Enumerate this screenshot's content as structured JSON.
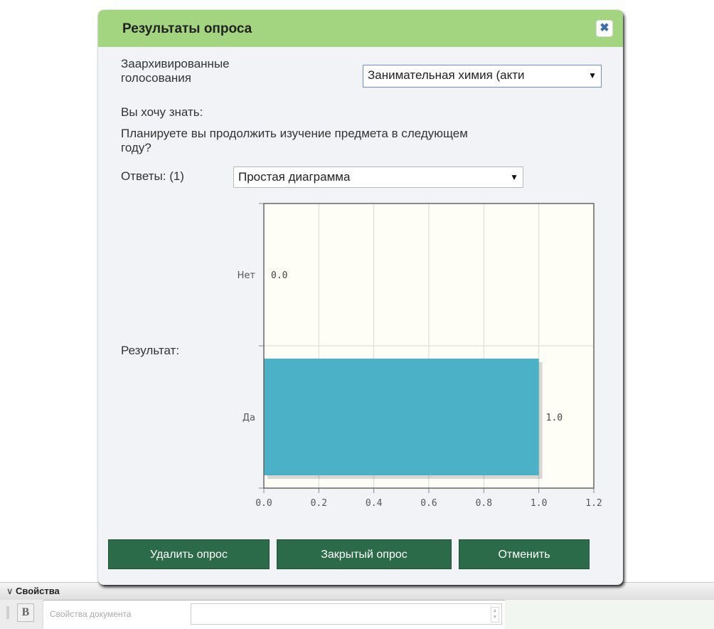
{
  "background": {
    "panel_title": "Свойства",
    "bold_button": "B",
    "property_label": "Свойства документа"
  },
  "dialog": {
    "title": "Результаты опроса",
    "close_icon": "close-icon",
    "archived_label": "Заархивированные голосования",
    "archived_label_line1": "Заархивированные",
    "archived_label_line2": "голосования",
    "archived_select_value": "Занимательная химия (акти",
    "want_to_know": "Вы хочу знать:",
    "question_line1": "Планируете вы продолжить изучение предмета в следующем",
    "question_line2": "году?",
    "answers_label": "Ответы: (1)",
    "chart_type_value": "Простая диаграмма",
    "result_label": "Результат:",
    "buttons": {
      "delete": "Удалить опрос",
      "closed": "Закрытый опрос",
      "cancel": "Отменить"
    }
  },
  "colors": {
    "header_green": "#a3d47f",
    "button_green": "#2c6b49",
    "bar_teal": "#4bb1c7",
    "plot_bg": "#fefdf6"
  },
  "chart_data": {
    "type": "bar",
    "orientation": "horizontal",
    "categories": [
      "Нет",
      "Да"
    ],
    "values": [
      0.0,
      1.0
    ],
    "value_labels": [
      "0.0",
      "1.0"
    ],
    "x_ticks": [
      "0.0",
      "0.2",
      "0.4",
      "0.6",
      "0.8",
      "1.0",
      "1.2"
    ],
    "xlim": [
      0,
      1.2
    ],
    "grid": true,
    "title": "",
    "xlabel": "",
    "ylabel": ""
  }
}
